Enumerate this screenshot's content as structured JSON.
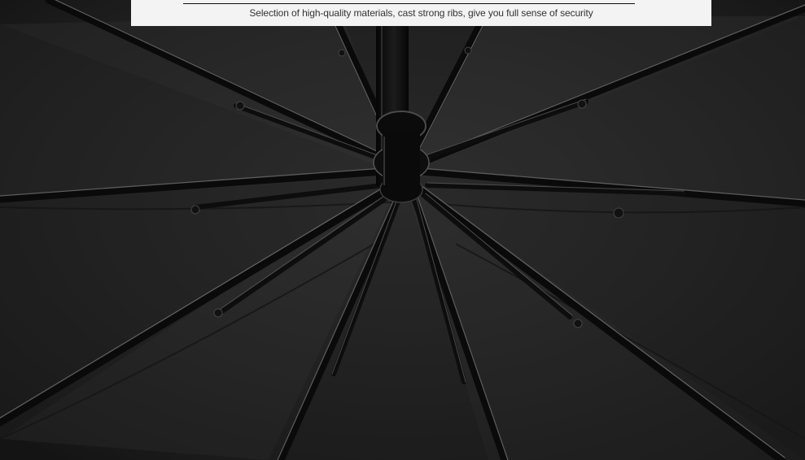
{
  "banner": {
    "caption": "Selection of high-quality materials, cast strong ribs, give you full sense of security"
  },
  "photo": {
    "subject": "umbrella-underside",
    "colors": {
      "canopy": "#262626",
      "rib": "#0a0a0a",
      "rib_highlight": "#6b6b6b",
      "caption_band": "#f3f3f3",
      "caption_text": "#333333"
    }
  }
}
